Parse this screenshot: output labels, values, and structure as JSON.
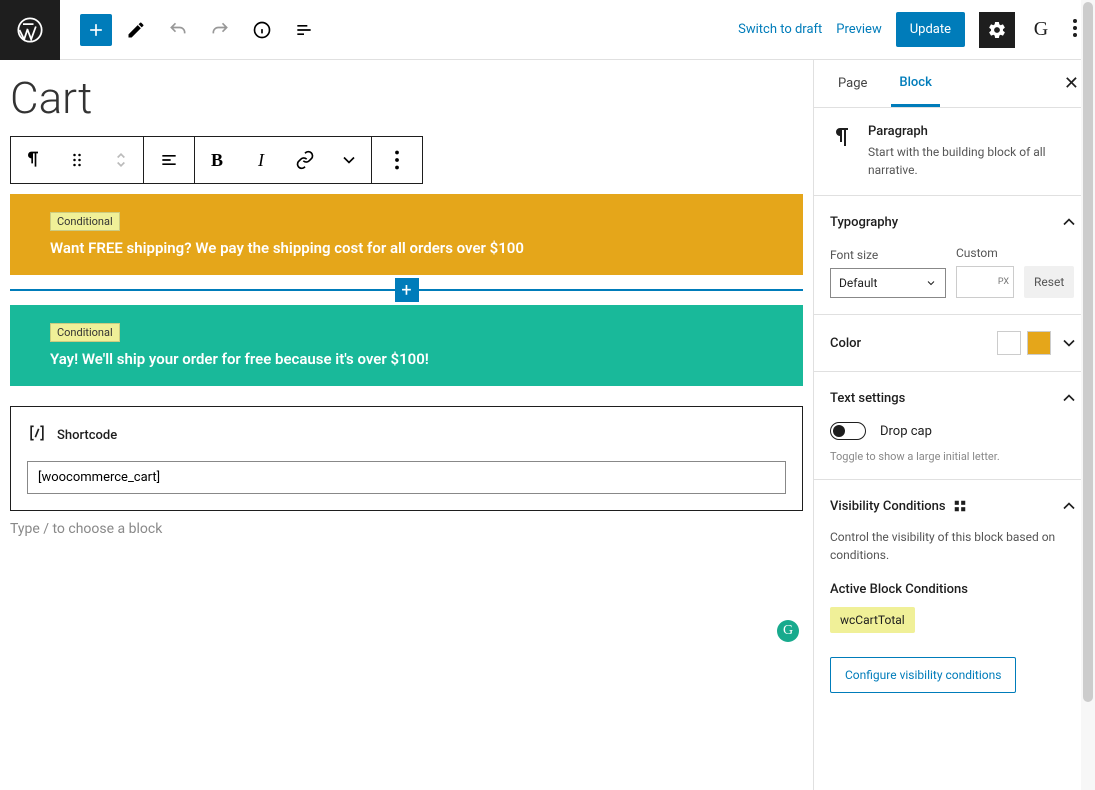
{
  "topbar": {
    "switch_draft": "Switch to draft",
    "preview": "Preview",
    "update": "Update"
  },
  "editor": {
    "page_title": "Cart",
    "blocks": [
      {
        "badge": "Conditional",
        "text": "Want FREE shipping? We pay the shipping cost for all orders over $100"
      },
      {
        "badge": "Conditional",
        "text": "Yay! We'll ship your order for free because it's over $100!"
      }
    ],
    "shortcode": {
      "label": "Shortcode",
      "value": "[woocommerce_cart]"
    },
    "placeholder": "Type / to choose a block"
  },
  "sidebar": {
    "tabs": {
      "page": "Page",
      "block": "Block"
    },
    "block_info": {
      "title": "Paragraph",
      "desc": "Start with the building block of all narrative."
    },
    "typography": {
      "title": "Typography",
      "font_size_label": "Font size",
      "font_size_value": "Default",
      "custom_label": "Custom",
      "custom_unit": "PX",
      "reset": "Reset"
    },
    "color": {
      "title": "Color"
    },
    "text_settings": {
      "title": "Text settings",
      "drop_cap": "Drop cap",
      "help": "Toggle to show a large initial letter."
    },
    "visibility": {
      "title": "Visibility Conditions",
      "desc": "Control the visibility of this block based on conditions.",
      "active_label": "Active Block Conditions",
      "active_condition": "wcCartTotal",
      "configure": "Configure visibility conditions"
    }
  }
}
